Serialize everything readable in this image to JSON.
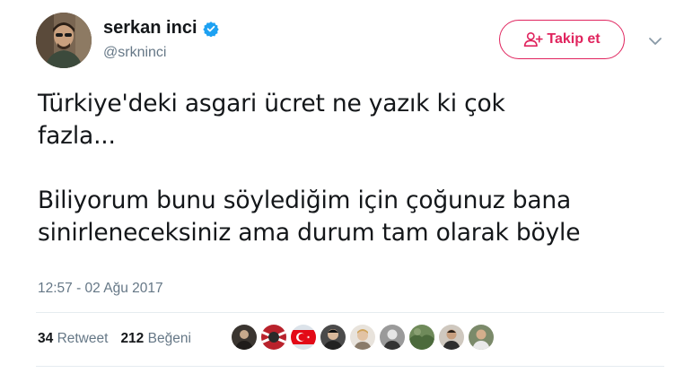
{
  "author": {
    "name": "serkan inci",
    "handle": "@srkninci",
    "verified": true
  },
  "follow_button": {
    "label": "Takip et",
    "color": "#e0245e"
  },
  "tweet": {
    "text": "Türkiye'deki asgari ücret ne yazık ki çok\nfazla...\n\nBiliyorum bunu söylediğim için çoğunuz bana\nsinirleneceksiniz ama durum tam olarak böyle",
    "timestamp": "12:57 - 02 Ağu 2017"
  },
  "stats": {
    "retweets": {
      "count": "34",
      "label": "Retweet"
    },
    "likes": {
      "count": "212",
      "label": "Beğeni"
    }
  },
  "likers": [
    {
      "icon": "liker-avatar-1"
    },
    {
      "icon": "liker-avatar-2"
    },
    {
      "icon": "liker-avatar-turkish-flag"
    },
    {
      "icon": "liker-avatar-4"
    },
    {
      "icon": "liker-avatar-5"
    },
    {
      "icon": "liker-avatar-6"
    },
    {
      "icon": "liker-avatar-7"
    },
    {
      "icon": "liker-avatar-8"
    },
    {
      "icon": "liker-avatar-9"
    }
  ],
  "colors": {
    "text": "#14171a",
    "secondary": "#657786",
    "verified": "#1da1f2",
    "divider": "#e6ecf0"
  }
}
